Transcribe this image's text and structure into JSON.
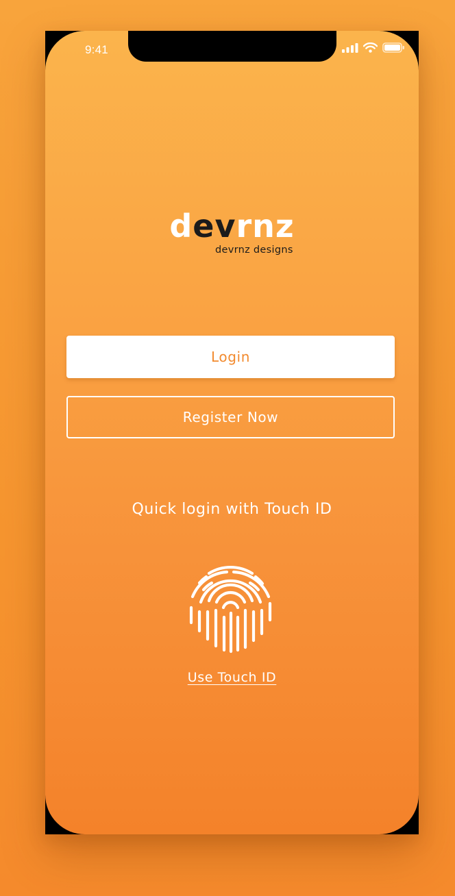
{
  "status_bar": {
    "time": "9:41",
    "icons": [
      "cellular-signal-icon",
      "wifi-icon",
      "battery-icon"
    ]
  },
  "brand": {
    "wordmark_light_1": "d",
    "wordmark_dark": "ev",
    "wordmark_light_2": "rnz",
    "tagline": "devrnz designs"
  },
  "actions": {
    "login_label": "Login",
    "register_label": "Register Now"
  },
  "touch_id": {
    "prompt": "Quick login with Touch ID",
    "icon": "fingerprint-icon",
    "link_label": "Use Touch ID"
  },
  "colors": {
    "accent": "#f28a2e",
    "background_top": "#fbb44c",
    "background_bottom": "#f4822a",
    "text_light": "#ffffff",
    "text_dark": "#1b1b1b"
  }
}
